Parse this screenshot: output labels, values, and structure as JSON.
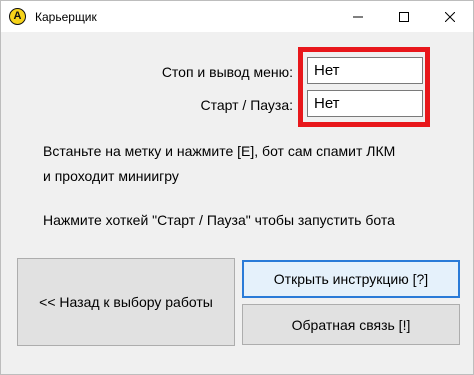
{
  "window": {
    "title": "Карьерщик",
    "icon_letter": "A",
    "icon_name": "app-logo-icon"
  },
  "controls": {
    "minimize_icon": "minimize-icon",
    "maximize_icon": "maximize-icon",
    "close_icon": "close-icon"
  },
  "form": {
    "stop_label": "Стоп и вывод меню:",
    "stop_value": "Нет",
    "start_label": "Старт / Пауза:",
    "start_value": "Нет"
  },
  "info": {
    "line1": "Встаньте на метку и нажмите [E], бот сам спамит ЛКМ",
    "line2": "и проходит миниигру",
    "line3": "Нажмите хоткей \"Старт / Пауза\" чтобы запустить бота"
  },
  "buttons": {
    "back": "<< Назад к выбору работы",
    "instructions": "Открыть инструкцию [?]",
    "feedback": "Обратная связь [!]"
  },
  "colors": {
    "highlight": "#e8171b",
    "focus": "#2a7bd8",
    "icon_bg": "#f6d31a"
  }
}
